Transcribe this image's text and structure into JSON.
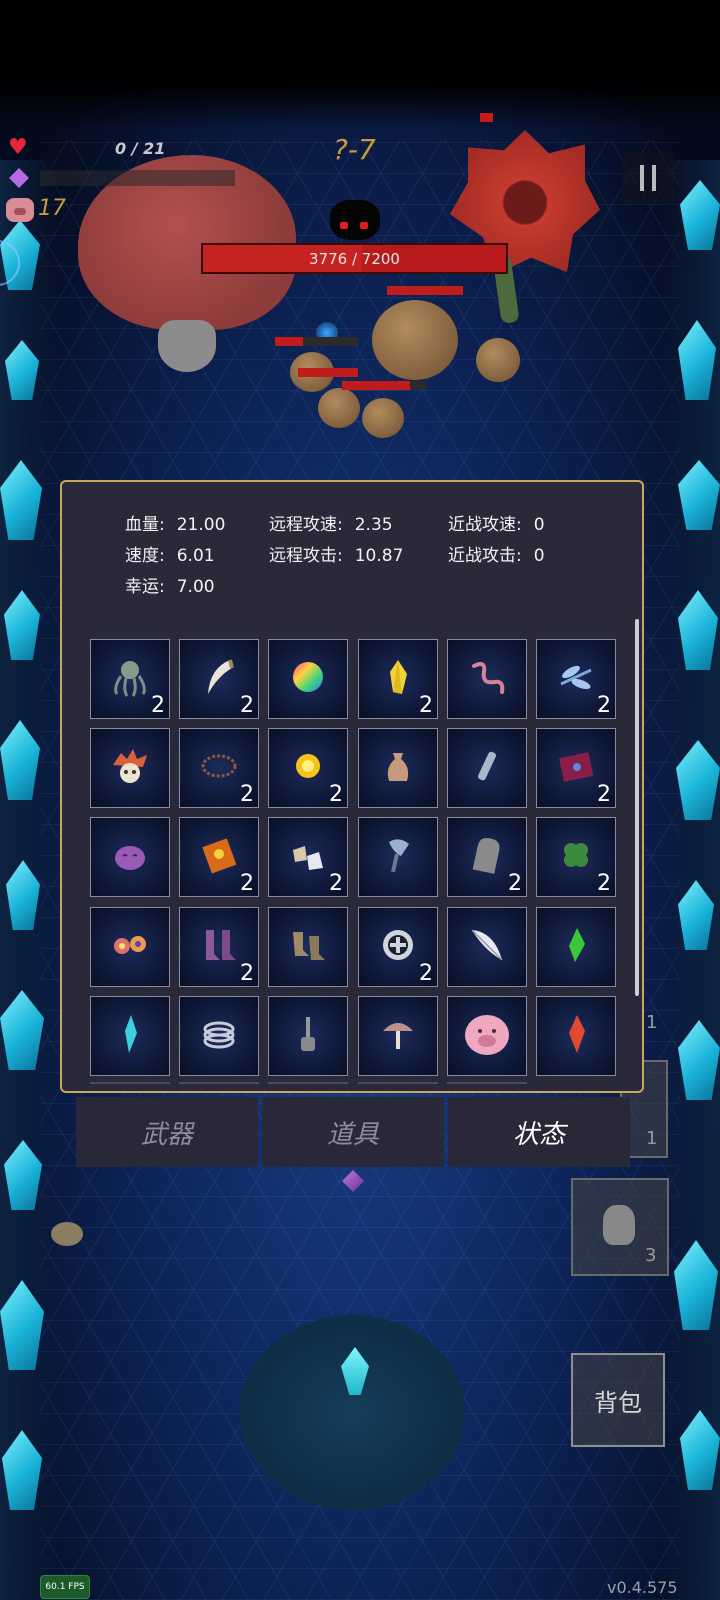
{
  "hud": {
    "xp_text": "0 / 21",
    "level_text": "?-7",
    "coins": "17",
    "boss_hp_text": "3776 / 7200",
    "boss_hp_fraction": 0.524,
    "heart_icon": "heart-icon",
    "gem_icon": "purple-gem-icon",
    "pig_icon": "pig-coin-icon"
  },
  "stats": {
    "hp_label": "血量:",
    "hp_value": "21.00",
    "speed_label": "速度:",
    "speed_value": "6.01",
    "luck_label": "幸运:",
    "luck_value": "7.00",
    "ranged_speed_label": "远程攻速:",
    "ranged_speed_value": "2.35",
    "ranged_attack_label": "远程攻击:",
    "ranged_attack_value": "10.87",
    "melee_speed_label": "近战攻速:",
    "melee_speed_value": "0",
    "melee_attack_label": "近战攻击:",
    "melee_attack_value": "0"
  },
  "items": [
    {
      "icon": "octopus-icon",
      "count": "2"
    },
    {
      "icon": "fang-icon",
      "count": "2"
    },
    {
      "icon": "rainbow-orb-icon",
      "count": ""
    },
    {
      "icon": "yellow-crystal-icon",
      "count": "2"
    },
    {
      "icon": "worm-icon",
      "count": ""
    },
    {
      "icon": "dragonfly-icon",
      "count": "2"
    },
    {
      "icon": "spiked-skull-icon",
      "count": ""
    },
    {
      "icon": "thorn-ring-icon",
      "count": "2"
    },
    {
      "icon": "sun-orb-icon",
      "count": "2"
    },
    {
      "icon": "pouch-icon",
      "count": ""
    },
    {
      "icon": "bottle-icon",
      "count": ""
    },
    {
      "icon": "spellbook-icon",
      "count": "2"
    },
    {
      "icon": "purple-slime-icon",
      "count": ""
    },
    {
      "icon": "golden-tome-icon",
      "count": "2"
    },
    {
      "icon": "ore-chunks-icon",
      "count": "2"
    },
    {
      "icon": "steel-axe-icon",
      "count": ""
    },
    {
      "icon": "tombstone-icon",
      "count": "2"
    },
    {
      "icon": "clover-icon",
      "count": "2"
    },
    {
      "icon": "flower-pair-icon",
      "count": ""
    },
    {
      "icon": "purple-boots-icon",
      "count": "2"
    },
    {
      "icon": "leather-boots-icon",
      "count": ""
    },
    {
      "icon": "cross-shield-ring-icon",
      "count": "2"
    },
    {
      "icon": "feather-icon",
      "count": ""
    },
    {
      "icon": "green-shard-icon",
      "count": ""
    },
    {
      "icon": "cyan-crystal-icon",
      "count": ""
    },
    {
      "icon": "spring-coil-icon",
      "count": ""
    },
    {
      "icon": "lantern-icon",
      "count": ""
    },
    {
      "icon": "mushroom-icon",
      "count": ""
    },
    {
      "icon": "piggy-bank-icon",
      "count": ""
    },
    {
      "icon": "red-crystal-icon",
      "count": ""
    }
  ],
  "tabs": [
    {
      "label": "武器",
      "active": false
    },
    {
      "label": "道具",
      "active": false
    },
    {
      "label": "状态",
      "active": true
    }
  ],
  "side_slots": {
    "slot1_count": "1",
    "slot2_count": "1",
    "slot3_count": "3"
  },
  "backpack_label": "背包",
  "fps_text": "60.1 FPS",
  "version_text": "v0.4.575"
}
